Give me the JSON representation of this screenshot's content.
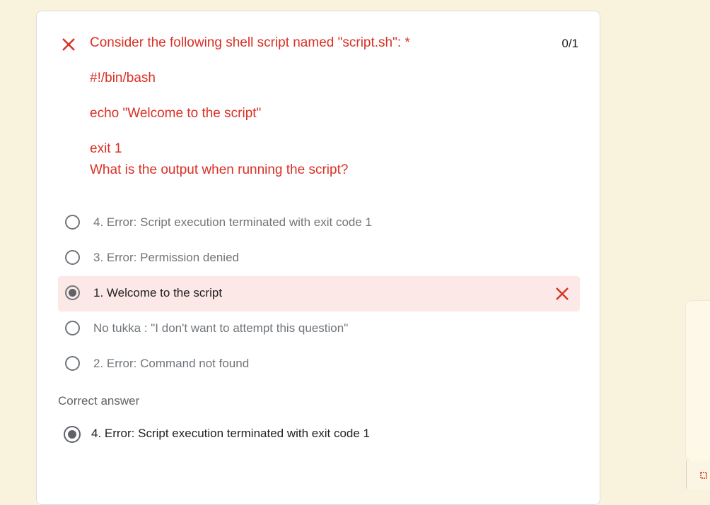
{
  "question": {
    "title": "Consider the following shell script named \"script.sh\": *",
    "score": "0/1",
    "status_icon": "close-icon",
    "code_lines": [
      "#!/bin/bash",
      "echo \"Welcome to the script\"",
      "exit 1"
    ],
    "prompt": "What is the output when running the script?"
  },
  "options": [
    {
      "label": "4. Error: Script execution terminated with exit code 1",
      "selected": false
    },
    {
      "label": "3. Error: Permission denied",
      "selected": false
    },
    {
      "label": "1. Welcome to the script",
      "selected": true,
      "incorrect": true
    },
    {
      "label": "No tukka : \"I don't want to attempt this question\"",
      "selected": false
    },
    {
      "label": "2. Error: Command not found",
      "selected": false
    }
  ],
  "correct_answer": {
    "heading": "Correct answer",
    "label": "4. Error: Script execution terminated with exit code 1"
  },
  "colors": {
    "incorrect": "#d93025",
    "incorrect_bg": "#fce8e6",
    "page_bg": "#f9f3de"
  }
}
